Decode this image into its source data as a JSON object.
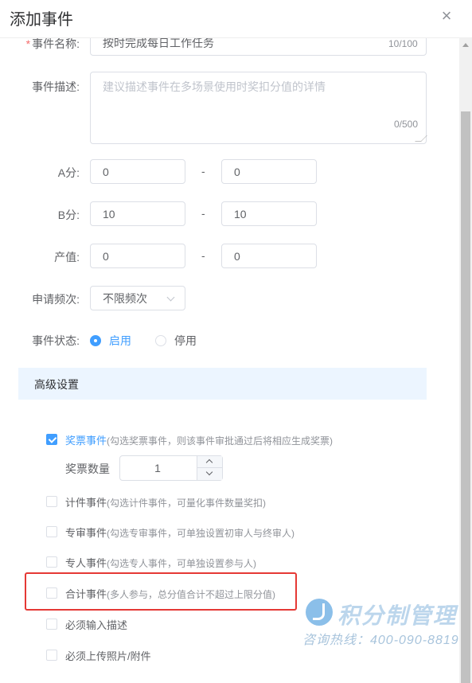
{
  "dialog": {
    "title": "添加事件"
  },
  "form": {
    "name": {
      "label": "事件名称:",
      "required_mark": "*",
      "value": "按时完成每日工作任务",
      "count": "10/100"
    },
    "desc": {
      "label": "事件描述:",
      "placeholder": "建议描述事件在多场景使用时奖扣分值的详情",
      "count": "0/500"
    },
    "a_score": {
      "label": "A分:",
      "from": "0",
      "sep": "-",
      "to": "0"
    },
    "b_score": {
      "label": "B分:",
      "from": "10",
      "sep": "-",
      "to": "10"
    },
    "output": {
      "label": "产值:",
      "from": "0",
      "sep": "-",
      "to": "0"
    },
    "frequency": {
      "label": "申请频次:",
      "value": "不限频次"
    },
    "status": {
      "label": "事件状态:",
      "options": [
        "启用",
        "停用"
      ],
      "selected": "启用"
    }
  },
  "advanced": {
    "title": "高级设置",
    "items": [
      {
        "label": "奖票事件",
        "hint": "(勾选奖票事件，则该事件审批通过后将相应生成奖票)",
        "checked": true
      },
      {
        "label": "计件事件",
        "hint": "(勾选计件事件，可量化事件数量奖扣)",
        "checked": false
      },
      {
        "label": "专审事件",
        "hint": "(勾选专审事件，可单独设置初审人与终审人)",
        "checked": false
      },
      {
        "label": "专人事件",
        "hint": "(勾选专人事件，可单独设置参与人)",
        "checked": false
      },
      {
        "label": "合计事件",
        "hint": "(多人参与，总分值合计不超过上限分值)",
        "checked": false
      },
      {
        "label": "必须输入描述",
        "hint": "",
        "checked": false
      },
      {
        "label": "必须上传照片/附件",
        "hint": "",
        "checked": false
      }
    ],
    "ticket_qty": {
      "label": "奖票数量",
      "value": "1"
    }
  },
  "watermark": {
    "brand": "积分制管理",
    "phone": "咨询热线：400-090-8819"
  },
  "colors": {
    "accent": "#409eff",
    "highlight": "#e53935",
    "section_bg": "#ecf5ff"
  }
}
